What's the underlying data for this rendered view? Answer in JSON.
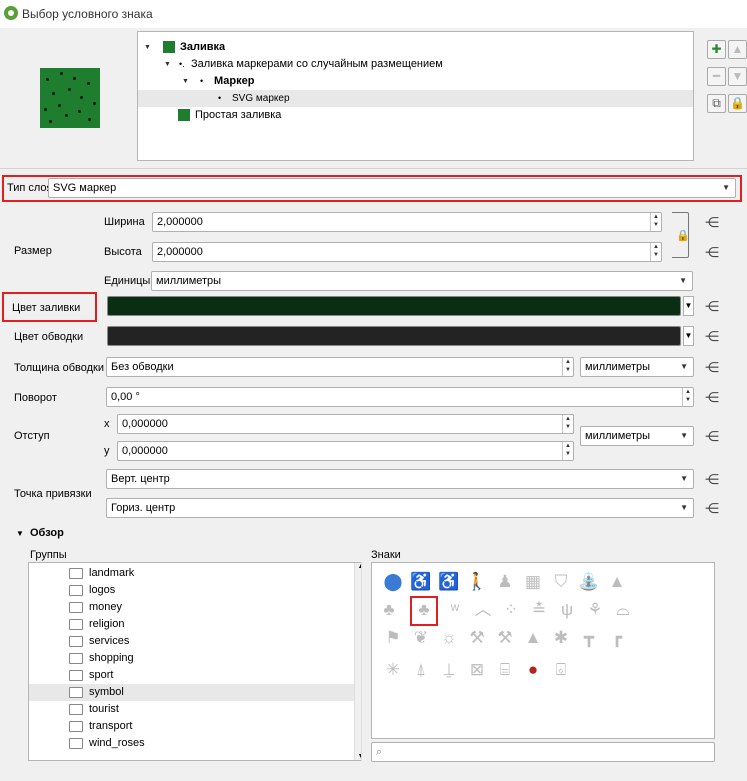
{
  "window": {
    "title": "Выбор условного знака"
  },
  "tree": {
    "items": [
      {
        "label": "Заливка",
        "level": 0,
        "bold": true
      },
      {
        "label": "Заливка маркерами со случайным размещением",
        "level": 1,
        "bold": false
      },
      {
        "label": "Маркер",
        "level": 2,
        "bold": true
      },
      {
        "label": "SVG маркер",
        "level": 3,
        "bold": false,
        "selected": true
      },
      {
        "label": "Простая заливка",
        "level": 1,
        "bold": false
      }
    ]
  },
  "layer_type": {
    "label": "Тип слоя",
    "value": "SVG маркер"
  },
  "size": {
    "label": "Размер",
    "width_label": "Ширина",
    "width_value": "2,000000",
    "height_label": "Высота",
    "height_value": "2,000000",
    "units_label": "Единицы",
    "units_value": "миллиметры"
  },
  "fill_color": {
    "label": "Цвет заливки",
    "color": "#0a2e14"
  },
  "stroke_color": {
    "label": "Цвет обводки",
    "color": "#232323"
  },
  "stroke_width": {
    "label": "Толщина обводки",
    "value": "Без обводки",
    "units": "миллиметры"
  },
  "rotation": {
    "label": "Поворот",
    "value": "0,00 °"
  },
  "offset": {
    "label": "Отступ",
    "x_label": "x",
    "x_value": "0,000000",
    "y_label": "y",
    "y_value": "0,000000",
    "units": "миллиметры"
  },
  "anchor": {
    "label": "Точка привязки",
    "vertical": "Верт. центр",
    "horizontal": "Гориз. центр"
  },
  "browse": {
    "title": "Обзор",
    "groups_label": "Группы",
    "groups": [
      "landmark",
      "logos",
      "money",
      "religion",
      "services",
      "shopping",
      "sport",
      "symbol",
      "tourist",
      "transport",
      "wind_roses"
    ],
    "selected_group": "symbol",
    "symbols_label": "Знаки",
    "search_placeholder": ""
  },
  "colors": {
    "accent_red": "#e02020",
    "preview_green": "#1e7d2e"
  }
}
